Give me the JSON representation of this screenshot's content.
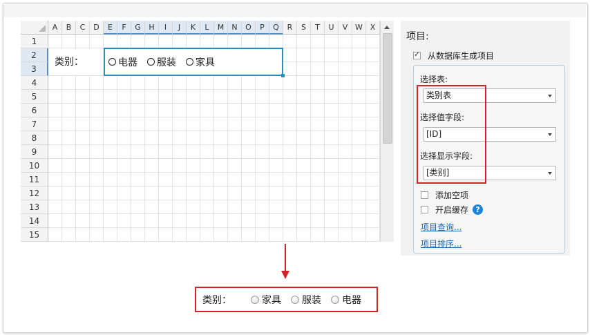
{
  "sheet": {
    "columns": [
      "A",
      "B",
      "C",
      "D",
      "E",
      "F",
      "G",
      "H",
      "I",
      "J",
      "K",
      "L",
      "M",
      "N",
      "O",
      "P",
      "Q",
      "R",
      "S",
      "T",
      "U",
      "V",
      "W",
      "X"
    ],
    "selected_columns": [
      "E",
      "F",
      "G",
      "H",
      "I",
      "J",
      "K",
      "L",
      "M",
      "N",
      "O",
      "P",
      "Q"
    ],
    "rows": [
      "1",
      "2",
      "3",
      "4",
      "5",
      "6",
      "7",
      "8",
      "9",
      "10",
      "11",
      "12",
      "13",
      "14",
      "15"
    ],
    "selected_rows": [
      "2",
      "3"
    ],
    "label_cell": "类别：",
    "radio_options": [
      "电器",
      "服装",
      "家具"
    ]
  },
  "panel": {
    "title": "项目:",
    "from_db_label": "从数据库生成项目",
    "from_db_checked": true,
    "select_table_label": "选择表:",
    "select_table_value": "类别表",
    "value_field_label": "选择值字段:",
    "value_field_value": "[ID]",
    "display_field_label": "选择显示字段:",
    "display_field_value": "[类别]",
    "add_empty_label": "添加空项",
    "add_empty_checked": false,
    "enable_cache_label": "开启缓存",
    "enable_cache_checked": false,
    "help_glyph": "?",
    "item_query_link": "项目查询...",
    "item_sort_link": "项目排序..."
  },
  "result": {
    "label": "类别：",
    "options": [
      "家具",
      "服装",
      "电器"
    ]
  },
  "colors": {
    "highlight_red": "#d0232a",
    "selection_blue": "#2b8fb8",
    "link_blue": "#1b67b3",
    "help_blue": "#1d84d6"
  }
}
